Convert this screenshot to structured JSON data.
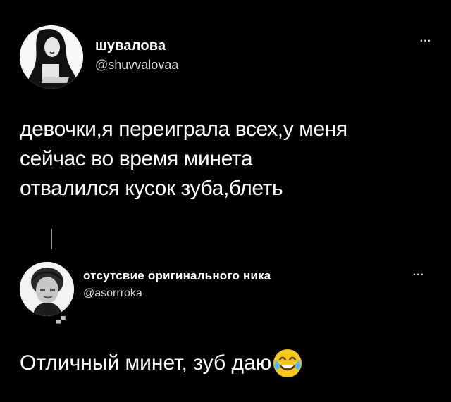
{
  "tweets": [
    {
      "author": {
        "name": "шувалова",
        "handle": "@shuvvalovaa",
        "avatar_icon": "avatar-icon"
      },
      "more_label": "...",
      "text": "девочки,я переиграла всех,у меня\nсейчас во время минета\nотвалился кусок зуба,блеть"
    },
    {
      "author": {
        "name": "отсутсвие оригинального ника",
        "handle": "@asorrroka",
        "avatar_icon": "avatar-icon"
      },
      "more_label": "...",
      "text": "Отличный минет, зуб даю",
      "emoji": "tears-of-joy-emoji"
    }
  ],
  "colors": {
    "background": "#000000",
    "text": "#ffffff",
    "secondary_text": "#d8d8d8",
    "thread_line": "#9b9b9b",
    "emoji_yellow": "#f6c81a"
  }
}
